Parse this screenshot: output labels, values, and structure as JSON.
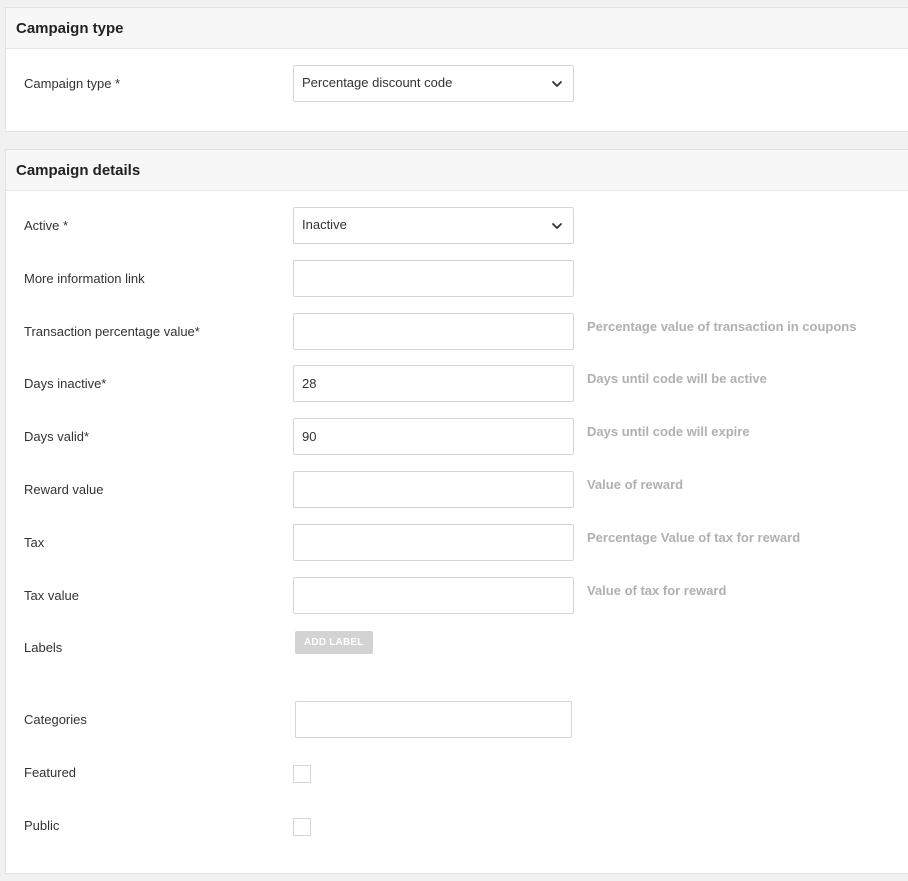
{
  "campaign_type_section": {
    "title": "Campaign type",
    "campaign_type": {
      "label": "Campaign type *",
      "value": "Percentage discount code",
      "icon": "chevron-down-icon"
    }
  },
  "campaign_details_section": {
    "title": "Campaign details",
    "active": {
      "label": "Active *",
      "value": "Inactive",
      "icon": "chevron-down-icon"
    },
    "more_information_link": {
      "label": "More information link",
      "value": ""
    },
    "transaction_percentage_value": {
      "label": "Transaction percentage value*",
      "value": "",
      "hint": "Percentage value of transaction in coupons"
    },
    "days_inactive": {
      "label": "Days inactive*",
      "value": "28",
      "hint": "Days until code will be active"
    },
    "days_valid": {
      "label": "Days valid*",
      "value": "90",
      "hint": "Days until code will expire"
    },
    "reward_value": {
      "label": "Reward value",
      "value": "",
      "hint": "Value of reward"
    },
    "tax": {
      "label": "Tax",
      "value": "",
      "hint": "Percentage Value of tax for reward"
    },
    "tax_value": {
      "label": "Tax value",
      "value": "",
      "hint": "Value of tax for reward"
    },
    "labels": {
      "label": "Labels",
      "button_label": "ADD LABEL"
    },
    "categories": {
      "label": "Categories",
      "value": ""
    },
    "featured": {
      "label": "Featured",
      "checked": false
    },
    "public": {
      "label": "Public",
      "checked": false
    }
  }
}
